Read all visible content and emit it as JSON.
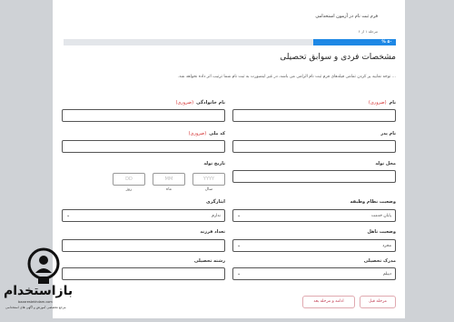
{
  "header": {
    "title": "فرم ثبت نام در آزمون استخدامی",
    "step_text": "مرحله ۱ از ۶"
  },
  "progress": {
    "percent_label": "۵۰ %",
    "fraction": 0.25
  },
  "section_title": "مشخصات فردی و سوابق تحصیلی",
  "notice": "... توجه نمایید پر کردن تمامی فیلدهای فرم ثبت نام الزامی می باشد، در غیر اینصورت به ثبت نام شما ترتیب اثر داده نخواهد شد.",
  "required_tag": "(ضروری)",
  "fields": {
    "first_name": "نام",
    "last_name": "نام خانوادگی",
    "father_name": "نام پدر",
    "national_code": "کد ملی",
    "birth_place": "محل تولد",
    "birth_date": "تاریخ تولد",
    "military_status": "وضعیت نظام وظیفه",
    "military_value": "پایان خدمت",
    "disability": "ایثارگری",
    "disability_value": "ندارم",
    "marital_status": "وضعیت تاهل",
    "marital_value": "مجرد",
    "children_count": "تعداد فرزند",
    "education": "مدرک تحصیلی",
    "education_value": "دیپلم",
    "field_of_study": "رشته تحصیلی"
  },
  "date": {
    "day_placeholder": "DD",
    "month_placeholder": "MM",
    "year_placeholder": "YYYY",
    "day_caption": "روز",
    "month_caption": "ماه",
    "year_caption": "سال"
  },
  "buttons": {
    "prev": "مرحله قبل",
    "next": "ادامه و مرحله بعد"
  },
  "logo": {
    "brand": "بازاستخدام",
    "site": "bazarestekhdam.com",
    "tagline": "مرجع تخصصی آموزش و آگهی های استخدامی"
  },
  "colors": {
    "progress_fill": "#1e88e5",
    "progress_track": "#e3e6ea",
    "required": "#d32f2f",
    "button": "#c0394f"
  }
}
